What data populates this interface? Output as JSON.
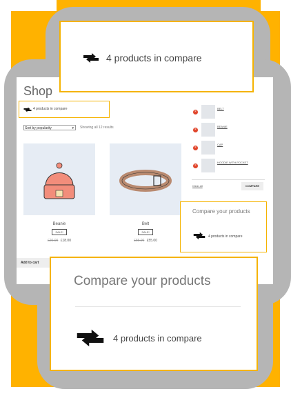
{
  "colors": {
    "background": "#FFB200",
    "border_accent": "#f5b300",
    "text_muted": "#777777",
    "remove_red": "#e0442a",
    "thumb_bg": "#e6ecf4"
  },
  "shop": {
    "title": "Shop",
    "compare_notice": "4 products in compare",
    "sort": {
      "selected": "Sort by popularity"
    },
    "result_count": "Showing all 12 results",
    "products": [
      {
        "name": "Beanie",
        "badge": "SALE!",
        "old_price": "£20.00",
        "price": "£18.00",
        "image_icon": "beanie-icon"
      },
      {
        "name": "Belt",
        "badge": "SALE!",
        "old_price": "£65.00",
        "price": "£55.00",
        "image_icon": "belt-icon"
      }
    ],
    "add_to_cart": "Add to cart"
  },
  "widget": {
    "items": [
      {
        "label": "BELT"
      },
      {
        "label": "BEANIE"
      },
      {
        "label": "CAP"
      },
      {
        "label": "HOODIE WITH POCKET"
      }
    ],
    "clear_all": "Clear all",
    "compare_button": "COMPARE"
  },
  "mid_compare": {
    "title": "Compare your products",
    "text": "4 products in compare"
  },
  "top_callout": {
    "text": "4 products in compare",
    "icon": "compare-arrows-icon"
  },
  "bottom_callout": {
    "title": "Compare your products",
    "text": "4 products in compare",
    "icon": "compare-arrows-icon"
  }
}
